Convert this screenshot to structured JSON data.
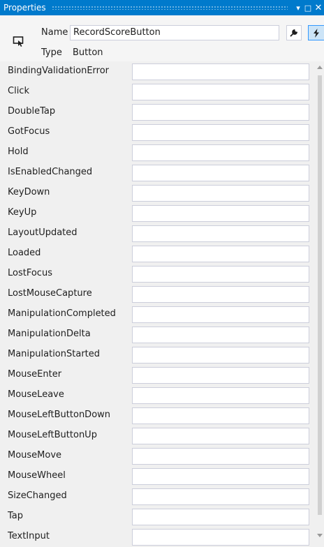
{
  "window": {
    "title": "Properties",
    "buttons": {
      "dropdown": "▾",
      "maximize": "□",
      "close": "✕"
    }
  },
  "header": {
    "name_label": "Name",
    "name_value": "RecordScoreButton",
    "type_label": "Type",
    "type_value": "Button",
    "icons": [
      "element-icon",
      "wrench-icon",
      "lightning-bolt-icon"
    ]
  },
  "events": [
    {
      "name": "BindingValidationError",
      "handler": ""
    },
    {
      "name": "Click",
      "handler": ""
    },
    {
      "name": "DoubleTap",
      "handler": ""
    },
    {
      "name": "GotFocus",
      "handler": ""
    },
    {
      "name": "Hold",
      "handler": ""
    },
    {
      "name": "IsEnabledChanged",
      "handler": ""
    },
    {
      "name": "KeyDown",
      "handler": ""
    },
    {
      "name": "KeyUp",
      "handler": ""
    },
    {
      "name": "LayoutUpdated",
      "handler": ""
    },
    {
      "name": "Loaded",
      "handler": ""
    },
    {
      "name": "LostFocus",
      "handler": ""
    },
    {
      "name": "LostMouseCapture",
      "handler": ""
    },
    {
      "name": "ManipulationCompleted",
      "handler": ""
    },
    {
      "name": "ManipulationDelta",
      "handler": ""
    },
    {
      "name": "ManipulationStarted",
      "handler": ""
    },
    {
      "name": "MouseEnter",
      "handler": ""
    },
    {
      "name": "MouseLeave",
      "handler": ""
    },
    {
      "name": "MouseLeftButtonDown",
      "handler": ""
    },
    {
      "name": "MouseLeftButtonUp",
      "handler": ""
    },
    {
      "name": "MouseMove",
      "handler": ""
    },
    {
      "name": "MouseWheel",
      "handler": ""
    },
    {
      "name": "SizeChanged",
      "handler": ""
    },
    {
      "name": "Tap",
      "handler": ""
    },
    {
      "name": "TextInput",
      "handler": ""
    }
  ],
  "colors": {
    "titlebar": "#007acc",
    "panel": "#f0f0f0",
    "field_border": "#cccedb",
    "selected_tab": "#cce4f7"
  }
}
